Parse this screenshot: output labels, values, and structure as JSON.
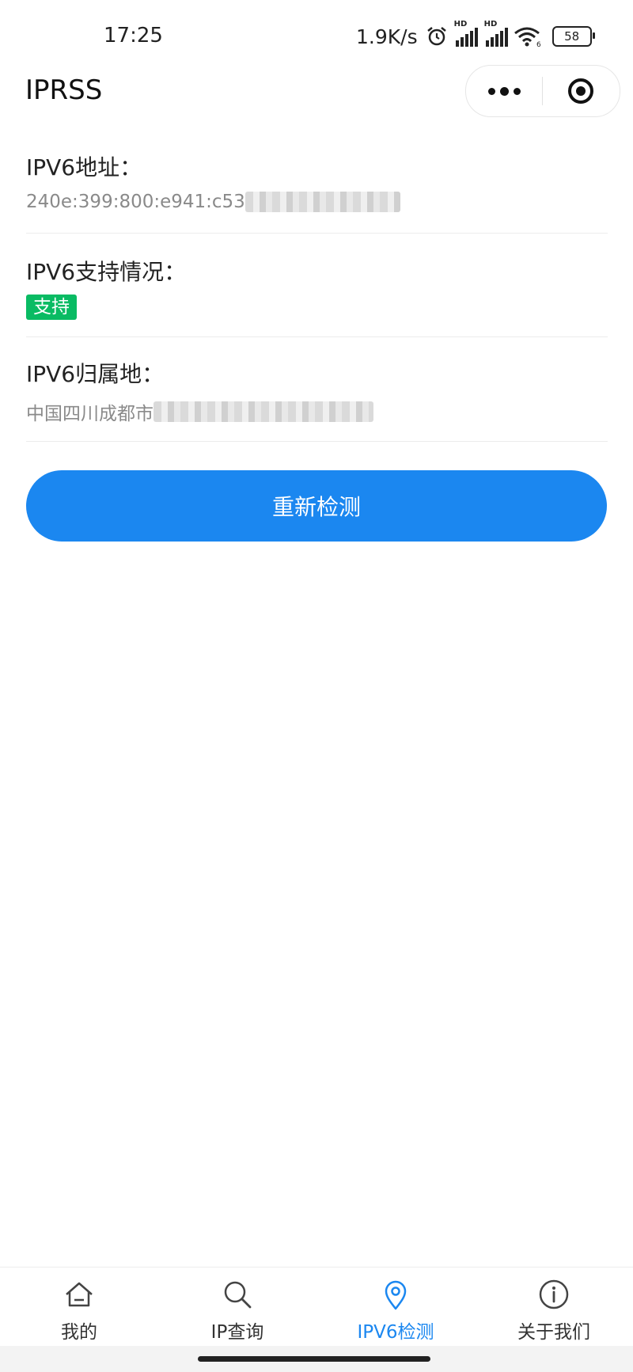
{
  "status_bar": {
    "time": "17:25",
    "net_speed": "1.9K/s",
    "battery": "58",
    "hd_label": "HD",
    "wifi_badge": "6"
  },
  "header": {
    "title": "IPRSS"
  },
  "sections": [
    {
      "label": "IPV6地址：",
      "value": "240e:399:800:e941:c53"
    },
    {
      "label": "IPV6支持情况：",
      "badge": "支持",
      "badge_color": "#09bb63"
    },
    {
      "label": "IPV6归属地：",
      "value": "中国四川成都市"
    }
  ],
  "recheck_button": "重新检测",
  "tabbar": {
    "active_color": "#1b87f0",
    "items": [
      {
        "label": "我的",
        "icon": "home-icon"
      },
      {
        "label": "IP查询",
        "icon": "search-icon"
      },
      {
        "label": "IPV6检测",
        "icon": "location-pin-icon",
        "active": true
      },
      {
        "label": "关于我们",
        "icon": "info-icon"
      }
    ]
  }
}
